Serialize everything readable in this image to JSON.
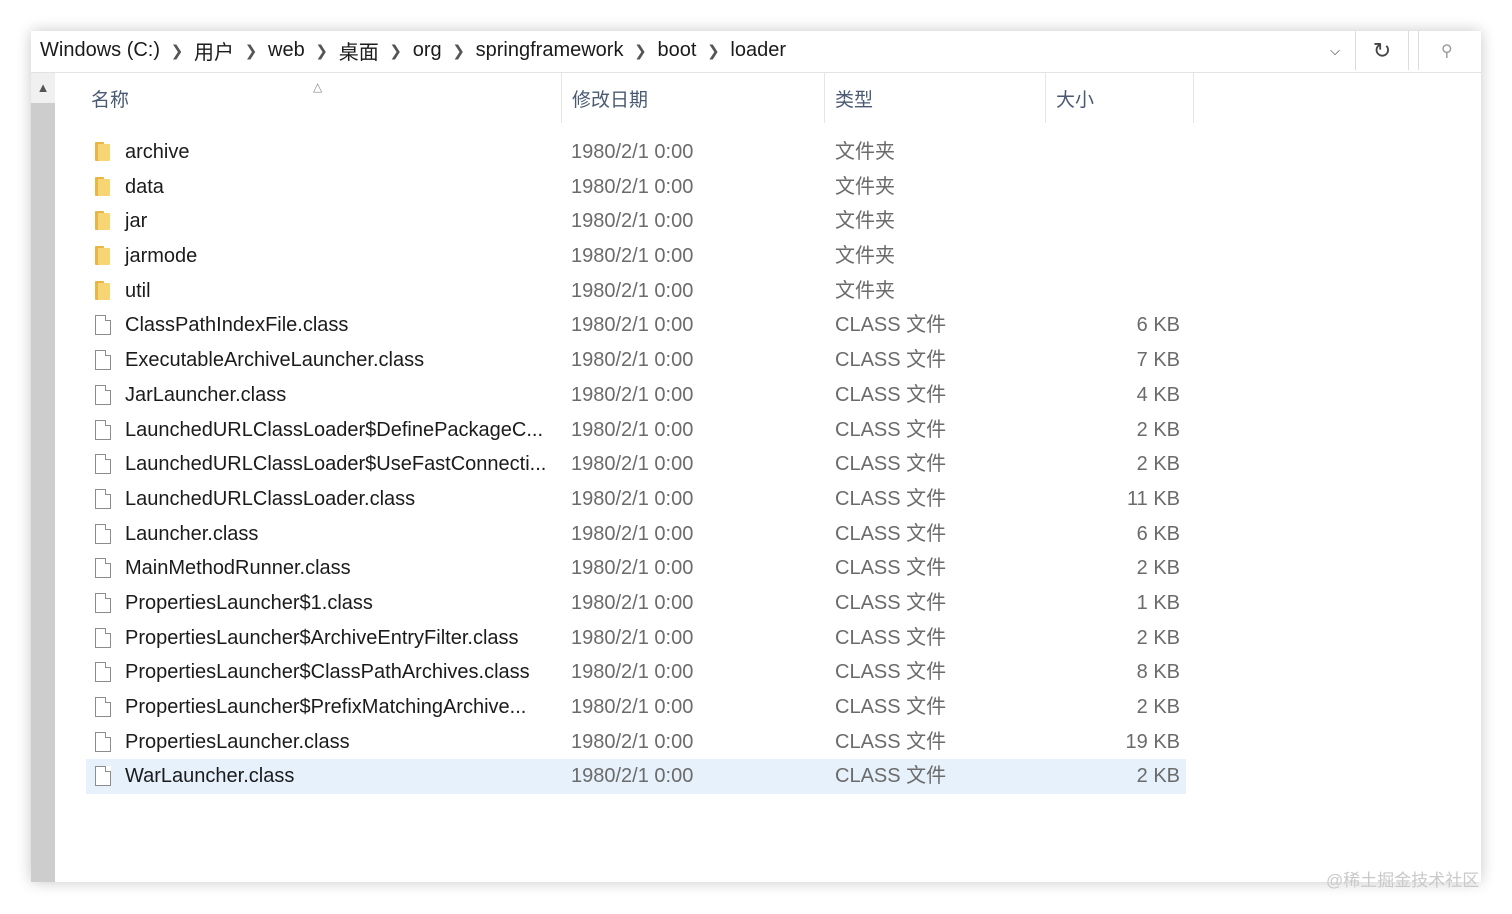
{
  "address_bar": {
    "breadcrumbs": [
      "Windows (C:)",
      "用户",
      "web",
      "桌面",
      "org",
      "springframework",
      "boot",
      "loader"
    ]
  },
  "columns": {
    "name": "名称",
    "date": "修改日期",
    "type": "类型",
    "size": "大小"
  },
  "files": [
    {
      "name": "archive",
      "date": "1980/2/1 0:00",
      "type": "文件夹",
      "size": "",
      "kind": "folder"
    },
    {
      "name": "data",
      "date": "1980/2/1 0:00",
      "type": "文件夹",
      "size": "",
      "kind": "folder"
    },
    {
      "name": "jar",
      "date": "1980/2/1 0:00",
      "type": "文件夹",
      "size": "",
      "kind": "folder"
    },
    {
      "name": "jarmode",
      "date": "1980/2/1 0:00",
      "type": "文件夹",
      "size": "",
      "kind": "folder"
    },
    {
      "name": "util",
      "date": "1980/2/1 0:00",
      "type": "文件夹",
      "size": "",
      "kind": "folder"
    },
    {
      "name": "ClassPathIndexFile.class",
      "date": "1980/2/1 0:00",
      "type": "CLASS 文件",
      "size": "6 KB",
      "kind": "file"
    },
    {
      "name": "ExecutableArchiveLauncher.class",
      "date": "1980/2/1 0:00",
      "type": "CLASS 文件",
      "size": "7 KB",
      "kind": "file"
    },
    {
      "name": "JarLauncher.class",
      "date": "1980/2/1 0:00",
      "type": "CLASS 文件",
      "size": "4 KB",
      "kind": "file"
    },
    {
      "name": "LaunchedURLClassLoader$DefinePackageC...",
      "date": "1980/2/1 0:00",
      "type": "CLASS 文件",
      "size": "2 KB",
      "kind": "file"
    },
    {
      "name": "LaunchedURLClassLoader$UseFastConnecti...",
      "date": "1980/2/1 0:00",
      "type": "CLASS 文件",
      "size": "2 KB",
      "kind": "file"
    },
    {
      "name": "LaunchedURLClassLoader.class",
      "date": "1980/2/1 0:00",
      "type": "CLASS 文件",
      "size": "11 KB",
      "kind": "file"
    },
    {
      "name": "Launcher.class",
      "date": "1980/2/1 0:00",
      "type": "CLASS 文件",
      "size": "6 KB",
      "kind": "file"
    },
    {
      "name": "MainMethodRunner.class",
      "date": "1980/2/1 0:00",
      "type": "CLASS 文件",
      "size": "2 KB",
      "kind": "file"
    },
    {
      "name": "PropertiesLauncher$1.class",
      "date": "1980/2/1 0:00",
      "type": "CLASS 文件",
      "size": "1 KB",
      "kind": "file"
    },
    {
      "name": "PropertiesLauncher$ArchiveEntryFilter.class",
      "date": "1980/2/1 0:00",
      "type": "CLASS 文件",
      "size": "2 KB",
      "kind": "file"
    },
    {
      "name": "PropertiesLauncher$ClassPathArchives.class",
      "date": "1980/2/1 0:00",
      "type": "CLASS 文件",
      "size": "8 KB",
      "kind": "file"
    },
    {
      "name": "PropertiesLauncher$PrefixMatchingArchive...",
      "date": "1980/2/1 0:00",
      "type": "CLASS 文件",
      "size": "2 KB",
      "kind": "file"
    },
    {
      "name": "PropertiesLauncher.class",
      "date": "1980/2/1 0:00",
      "type": "CLASS 文件",
      "size": "19 KB",
      "kind": "file"
    },
    {
      "name": "WarLauncher.class",
      "date": "1980/2/1 0:00",
      "type": "CLASS 文件",
      "size": "2 KB",
      "kind": "file",
      "selected": true
    }
  ],
  "watermark": "@稀土掘金技术社区",
  "colors": {
    "folder": "#f8d574",
    "selection": "#e6f1fb",
    "header_text": "#4a5a73"
  },
  "icons": [
    "chevron-right-icon",
    "chevron-down-icon",
    "refresh-icon",
    "search-icon",
    "sort-up-icon",
    "scroll-up-icon",
    "folder-icon",
    "file-icon"
  ]
}
